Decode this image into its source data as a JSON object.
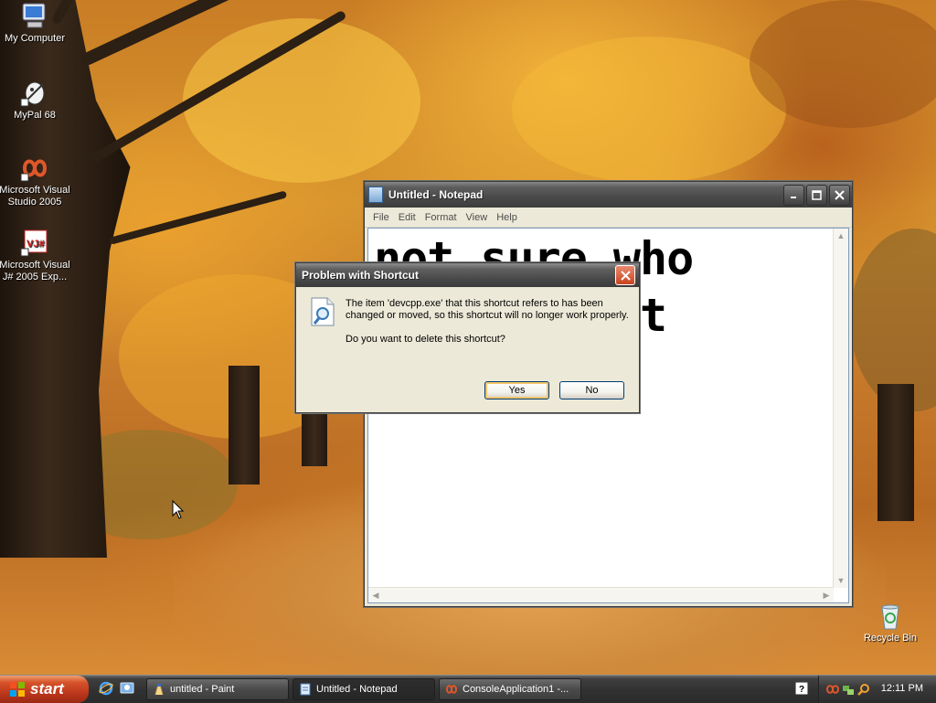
{
  "desktop": {
    "icons": [
      {
        "label": "My Computer",
        "icon": "my-computer-icon"
      },
      {
        "label": "MyPal 68",
        "icon": "mypal-icon"
      },
      {
        "label": "Microsoft Visual Studio 2005",
        "icon": "visual-studio-icon"
      },
      {
        "label": "Microsoft Visual J# 2005 Exp...",
        "icon": "visual-jsharp-icon"
      },
      {
        "label": "Recycle Bin",
        "icon": "recycle-bin-icon"
      }
    ]
  },
  "notepad": {
    "title": "Untitled - Notepad",
    "menu": [
      "File",
      "Edit",
      "Format",
      "View",
      "Help"
    ],
    "text": "not sure who\nmade it but\ntoo"
  },
  "dialog": {
    "title": "Problem with Shortcut",
    "message": "The item 'devcpp.exe' that this shortcut refers to has been changed or moved, so this shortcut will no longer work properly.",
    "question": "Do you want to delete this shortcut?",
    "yes_label": "Yes",
    "no_label": "No"
  },
  "taskbar": {
    "start_label": "start",
    "tasks": [
      {
        "label": "untitled - Paint",
        "icon": "paint-icon"
      },
      {
        "label": "Untitled - Notepad",
        "icon": "notepad-icon"
      },
      {
        "label": "ConsoleApplication1 -...",
        "icon": "visual-studio-icon"
      }
    ],
    "clock": "12:11 PM"
  },
  "colors": {
    "taskbar": "#323232",
    "start": "#d6522a",
    "wallpaper": "#d9962e"
  }
}
